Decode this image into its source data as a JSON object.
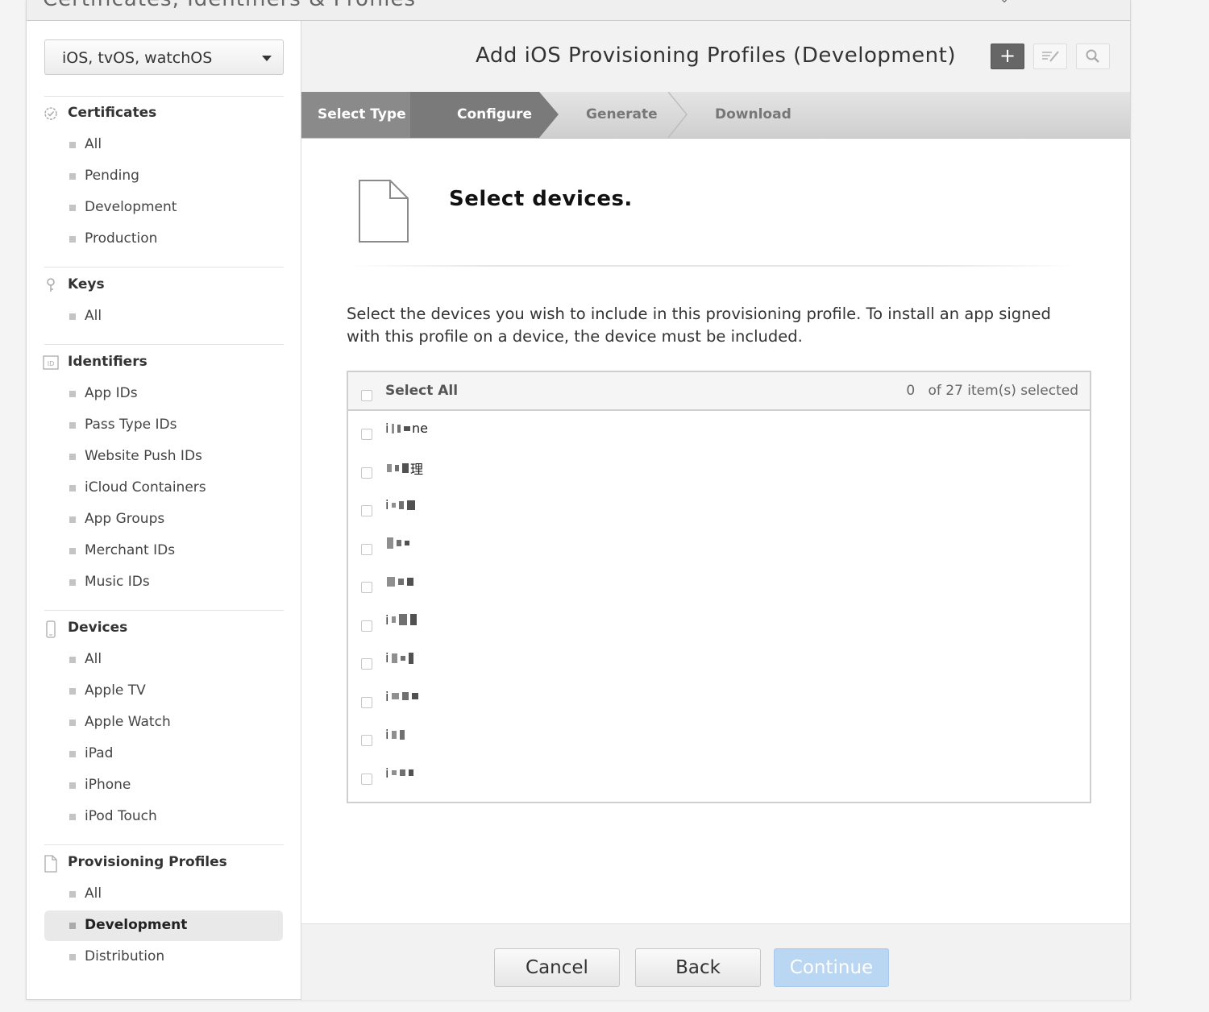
{
  "app": {
    "title": "Certificates, Identifiers & Profiles"
  },
  "sidebar": {
    "platform": "iOS, tvOS, watchOS",
    "sections": [
      {
        "title": "Certificates",
        "icon": "certificate-icon",
        "items": [
          "All",
          "Pending",
          "Development",
          "Production"
        ]
      },
      {
        "title": "Keys",
        "icon": "key-icon",
        "items": [
          "All"
        ]
      },
      {
        "title": "Identifiers",
        "icon": "id-badge-icon",
        "icon_text": "ID",
        "items": [
          "App IDs",
          "Pass Type IDs",
          "Website Push IDs",
          "iCloud Containers",
          "App Groups",
          "Merchant IDs",
          "Music IDs"
        ]
      },
      {
        "title": "Devices",
        "icon": "device-icon",
        "items": [
          "All",
          "Apple TV",
          "Apple Watch",
          "iPad",
          "iPhone",
          "iPod Touch"
        ]
      },
      {
        "title": "Provisioning Profiles",
        "icon": "document-icon",
        "items": [
          "All",
          "Development",
          "Distribution"
        ],
        "active_item": "Development"
      }
    ]
  },
  "main": {
    "title": "Add iOS Provisioning Profiles (Development)",
    "header_buttons": {
      "add": "+",
      "edit": "edit-icon",
      "search": "search-icon"
    },
    "steps": [
      "Select Type",
      "Configure",
      "Generate",
      "Download"
    ],
    "current_step": "Configure",
    "heading": "Select devices.",
    "instructions": "Select the devices you wish to include in this provisioning profile. To install an app signed with this profile on a device, the device must be included.",
    "device_list": {
      "select_all_label": "Select All",
      "selected_count": "0",
      "count_suffix": "of 27 item(s) selected",
      "devices": [
        {
          "prefix": "i",
          "suffix": "ne",
          "blur": [
            [
              3,
              12
            ],
            [
              4,
              10
            ],
            [
              8,
              6
            ]
          ]
        },
        {
          "prefix": "",
          "suffix": "理",
          "blur": [
            [
              6,
              10
            ],
            [
              5,
              8
            ],
            [
              8,
              12
            ]
          ]
        },
        {
          "prefix": "i",
          "suffix": "",
          "blur": [
            [
              5,
              6
            ],
            [
              6,
              10
            ],
            [
              10,
              12
            ]
          ]
        },
        {
          "prefix": "",
          "suffix": "",
          "blur": [
            [
              8,
              14
            ],
            [
              6,
              8
            ],
            [
              6,
              6
            ]
          ]
        },
        {
          "prefix": "",
          "suffix": "",
          "blur": [
            [
              10,
              12
            ],
            [
              7,
              8
            ],
            [
              8,
              10
            ]
          ]
        },
        {
          "prefix": "i",
          "suffix": "",
          "blur": [
            [
              5,
              8
            ],
            [
              10,
              14
            ],
            [
              8,
              14
            ]
          ]
        },
        {
          "prefix": "i",
          "suffix": "",
          "blur": [
            [
              7,
              12
            ],
            [
              6,
              6
            ],
            [
              6,
              14
            ]
          ]
        },
        {
          "prefix": "i",
          "suffix": "",
          "blur": [
            [
              9,
              8
            ],
            [
              8,
              10
            ],
            [
              8,
              8
            ]
          ]
        },
        {
          "prefix": "i",
          "suffix": "",
          "blur": [
            [
              6,
              10
            ],
            [
              6,
              12
            ]
          ]
        },
        {
          "prefix": "i",
          "suffix": "",
          "blur": [
            [
              6,
              6
            ],
            [
              7,
              8
            ],
            [
              6,
              8
            ]
          ]
        }
      ]
    },
    "footer": {
      "cancel": "Cancel",
      "back": "Back",
      "continue": "Continue"
    }
  },
  "colors": {
    "accent_disabled": "#b9d6f2",
    "step_active": "#7a7a7a",
    "active_item_bg": "#e9e9e9"
  }
}
